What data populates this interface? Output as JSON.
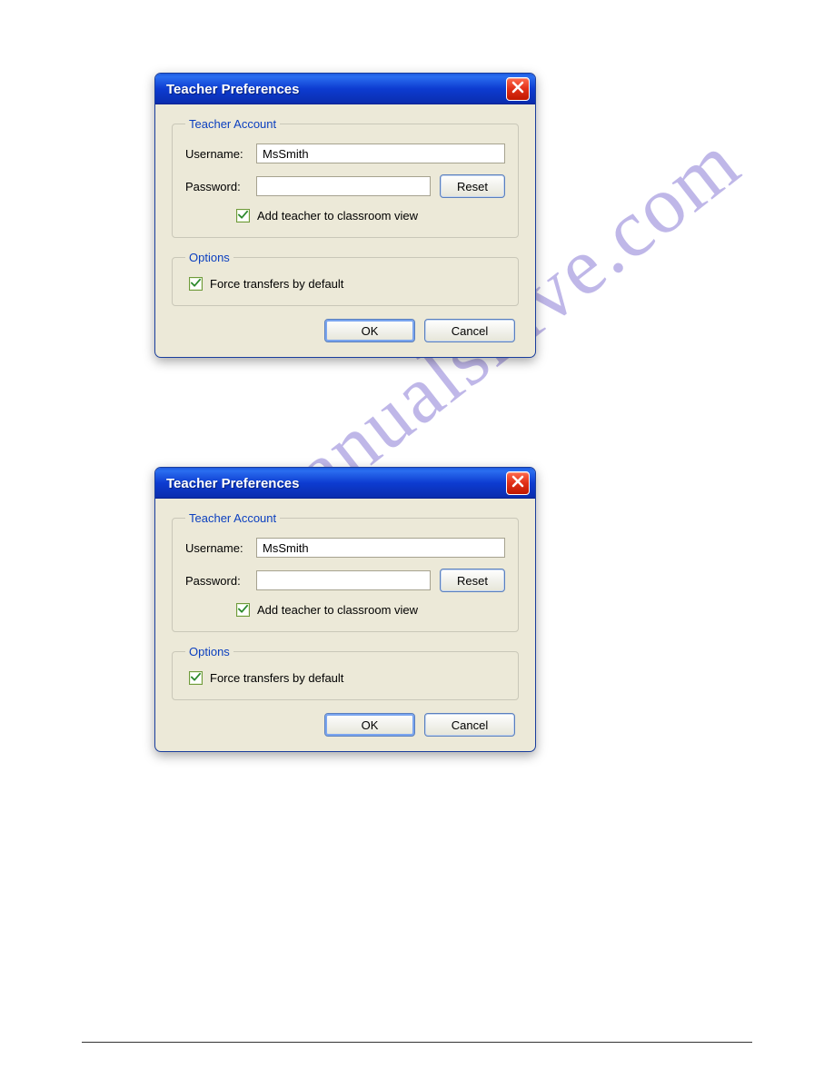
{
  "watermark": "manualshive.com",
  "dialog": {
    "title": "Teacher Preferences",
    "teacherAccount": {
      "legend": "Teacher Account",
      "usernameLabel": "Username:",
      "usernameValue": "MsSmith",
      "passwordLabel": "Password:",
      "passwordValue": "",
      "resetLabel": "Reset",
      "addTeacherChecked": true,
      "addTeacherLabel": "Add teacher to classroom view"
    },
    "options": {
      "legend": "Options",
      "forceChecked": true,
      "forceLabel": "Force transfers by default"
    },
    "okLabel": "OK",
    "cancelLabel": "Cancel"
  }
}
